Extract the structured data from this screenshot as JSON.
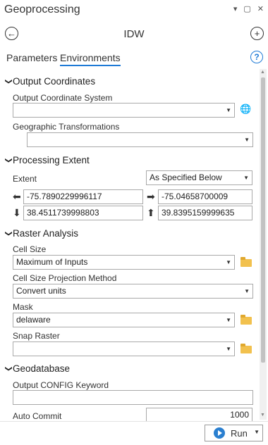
{
  "window": {
    "title": "Geoprocessing",
    "controls": [
      "▾",
      "▢",
      "✕"
    ]
  },
  "header": {
    "back_icon": "←",
    "tool_name": "IDW",
    "add_icon": "+"
  },
  "tabs": [
    {
      "label": "Parameters",
      "active": false
    },
    {
      "label": "Environments",
      "active": true
    }
  ],
  "help_label": "?",
  "sections": {
    "output_coordinates": {
      "title": "Output Coordinates",
      "output_coordinate_system": {
        "label": "Output Coordinate System",
        "value": ""
      },
      "geographic_transformations": {
        "label": "Geographic Transformations",
        "value": ""
      }
    },
    "processing_extent": {
      "title": "Processing Extent",
      "extent_label": "Extent",
      "extent_value": "As Specified Below",
      "left": "-75.7890229996117",
      "right": "-75.04658700009",
      "bottom": "38.4511739998803",
      "top": "39.8395159999635"
    },
    "raster_analysis": {
      "title": "Raster Analysis",
      "cell_size": {
        "label": "Cell Size",
        "value": "Maximum of Inputs"
      },
      "cell_size_projection": {
        "label": "Cell Size Projection Method",
        "value": "Convert units"
      },
      "mask": {
        "label": "Mask",
        "value": "delaware"
      },
      "snap_raster": {
        "label": "Snap Raster",
        "value": ""
      }
    },
    "geodatabase": {
      "title": "Geodatabase",
      "output_config_keyword": {
        "label": "Output CONFIG Keyword",
        "value": ""
      },
      "auto_commit": {
        "label": "Auto Commit",
        "value": "1000"
      }
    }
  },
  "run_button": {
    "label": "Run"
  },
  "colors": {
    "accent": "#1e7ad6",
    "folder": "#f2c14e"
  }
}
